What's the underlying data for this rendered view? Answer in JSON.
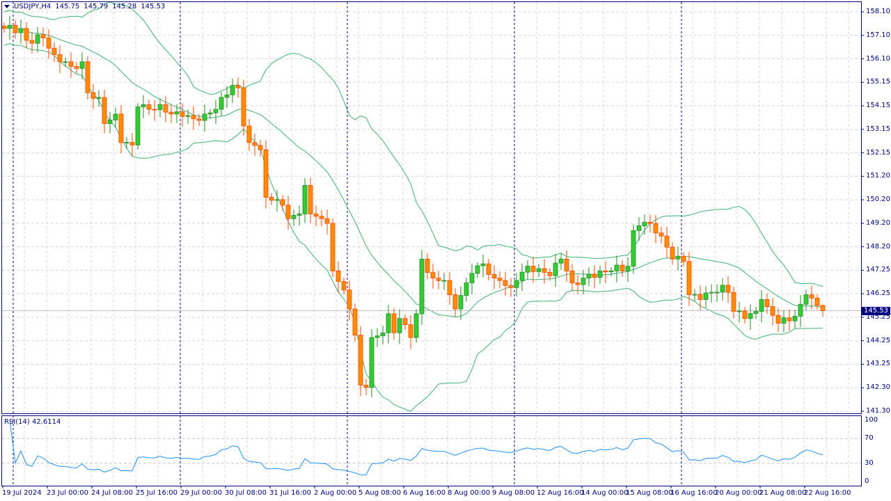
{
  "header": {
    "symbol": "USDJPY,H4",
    "open": "145.75",
    "high": "145.79",
    "low": "145.28",
    "close": "145.53"
  },
  "current_price": "145.53",
  "price_axis": [
    "158.10",
    "157.10",
    "156.10",
    "155.15",
    "154.15",
    "153.15",
    "152.15",
    "151.20",
    "150.20",
    "149.20",
    "148.20",
    "147.25",
    "146.25",
    "145.25",
    "144.25",
    "143.25",
    "142.30",
    "141.30"
  ],
  "time_axis": [
    "19 Jul 2024",
    "23 Jul 00:00",
    "24 Jul 08:00",
    "25 Jul 16:00",
    "29 Jul 00:00",
    "30 Jul 08:00",
    "31 Jul 16:00",
    "2 Aug 00:00",
    "5 Aug 08:00",
    "6 Aug 16:00",
    "8 Aug 00:00",
    "9 Aug 08:00",
    "12 Aug 16:00",
    "14 Aug 00:00",
    "15 Aug 08:00",
    "16 Aug 16:00",
    "20 Aug 00:00",
    "21 Aug 08:00",
    "22 Aug 16:00"
  ],
  "rsi": {
    "label": "RSI(14) 42.6114",
    "levels": [
      "100",
      "70",
      "30",
      "0"
    ]
  },
  "colors": {
    "bull": "#32cd32",
    "bear": "#ff8c00",
    "band": "#3cb371",
    "rsi": "#1e90ff",
    "axis": "#000080"
  },
  "chart_data": {
    "type": "candlestick",
    "symbol": "USDJPY",
    "timeframe": "H4",
    "ylim": [
      141.3,
      158.1
    ],
    "bars": 148,
    "close_keypoints": [
      [
        0,
        157.4
      ],
      [
        3,
        157.4
      ],
      [
        4,
        156.9
      ],
      [
        7,
        157.0
      ],
      [
        9,
        156.3
      ],
      [
        11,
        156.0
      ],
      [
        12,
        155.8
      ],
      [
        14,
        156.0
      ],
      [
        15,
        154.7
      ],
      [
        17,
        154.5
      ],
      [
        18,
        153.4
      ],
      [
        20,
        153.8
      ],
      [
        21,
        152.6
      ],
      [
        23,
        152.5
      ],
      [
        24,
        154.1
      ],
      [
        26,
        154.0
      ],
      [
        28,
        154.2
      ],
      [
        30,
        153.8
      ],
      [
        32,
        153.7
      ],
      [
        34,
        153.6
      ],
      [
        36,
        153.8
      ],
      [
        38,
        154.0
      ],
      [
        39,
        154.5
      ],
      [
        41,
        155.0
      ],
      [
        42,
        154.9
      ],
      [
        43,
        153.3
      ],
      [
        44,
        152.6
      ],
      [
        46,
        152.3
      ],
      [
        47,
        150.3
      ],
      [
        49,
        150.2
      ],
      [
        51,
        149.4
      ],
      [
        53,
        149.6
      ],
      [
        54,
        150.8
      ],
      [
        55,
        149.6
      ],
      [
        57,
        149.4
      ],
      [
        58,
        149.2
      ],
      [
        59,
        147.2
      ],
      [
        61,
        146.4
      ],
      [
        62,
        145.6
      ],
      [
        63,
        144.5
      ],
      [
        64,
        142.4
      ],
      [
        65,
        142.3
      ],
      [
        66,
        144.4
      ],
      [
        68,
        144.6
      ],
      [
        69,
        145.4
      ],
      [
        70,
        144.6
      ],
      [
        71,
        145.2
      ],
      [
        73,
        144.4
      ],
      [
        74,
        145.4
      ],
      [
        75,
        147.7
      ],
      [
        77,
        146.9
      ],
      [
        79,
        146.8
      ],
      [
        80,
        146.2
      ],
      [
        81,
        145.6
      ],
      [
        83,
        146.7
      ],
      [
        84,
        147.1
      ],
      [
        86,
        147.5
      ],
      [
        88,
        146.9
      ],
      [
        89,
        146.8
      ],
      [
        91,
        146.5
      ],
      [
        92,
        146.8
      ],
      [
        94,
        147.4
      ],
      [
        96,
        147.3
      ],
      [
        98,
        147.0
      ],
      [
        100,
        147.7
      ],
      [
        101,
        147.2
      ],
      [
        102,
        146.7
      ],
      [
        104,
        146.9
      ],
      [
        107,
        147.2
      ],
      [
        109,
        147.2
      ],
      [
        112,
        147.4
      ],
      [
        113,
        148.9
      ],
      [
        114,
        149.1
      ],
      [
        116,
        149.2
      ],
      [
        117,
        148.8
      ],
      [
        119,
        148.2
      ],
      [
        120,
        147.7
      ],
      [
        122,
        147.6
      ],
      [
        123,
        146.2
      ],
      [
        125,
        146.0
      ],
      [
        127,
        146.3
      ],
      [
        129,
        146.6
      ],
      [
        130,
        146.3
      ],
      [
        131,
        145.5
      ],
      [
        133,
        145.2
      ],
      [
        135,
        145.5
      ],
      [
        136,
        146.0
      ],
      [
        137,
        145.7
      ],
      [
        139,
        145.0
      ],
      [
        141,
        145.1
      ],
      [
        142,
        145.3
      ],
      [
        143,
        145.8
      ],
      [
        144,
        146.2
      ],
      [
        146,
        145.75
      ],
      [
        147,
        145.53
      ]
    ],
    "last_bar": {
      "open": 145.75,
      "high": 145.79,
      "low": 145.28,
      "close": 145.53
    },
    "indicators": [
      "Bollinger Bands(20,2)",
      "RSI(14)"
    ],
    "rsi_last": 42.6114
  }
}
